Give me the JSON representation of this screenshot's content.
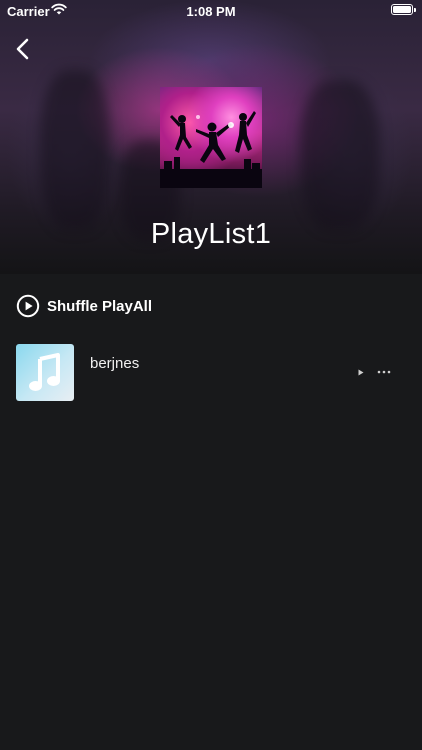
{
  "status_bar": {
    "carrier": "Carrier",
    "time": "1:08 PM"
  },
  "header": {
    "back_icon": "chevron-left-icon",
    "playlist_title": "PlayList1"
  },
  "actions": {
    "shuffle_label": "Shuffle PlayAll",
    "shuffle_icon": "play-circle-icon"
  },
  "tracks": [
    {
      "title": "berjnes",
      "artwork_icon": "music-note-icon"
    }
  ],
  "colors": {
    "background": "#18191b",
    "text": "#ffffff",
    "artwork_placeholder": "#8ad8ee"
  }
}
